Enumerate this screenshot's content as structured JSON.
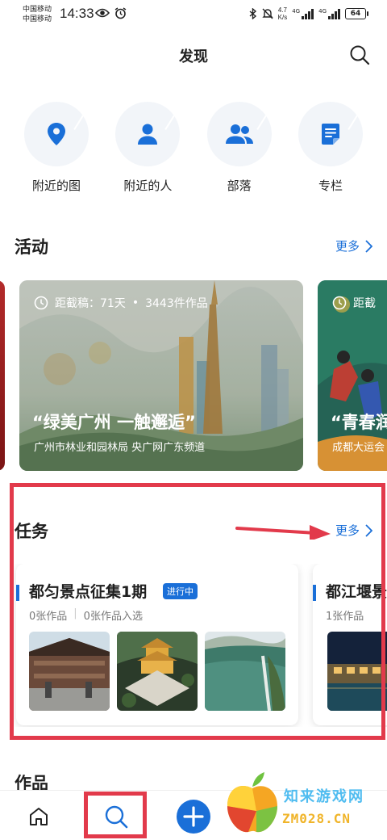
{
  "status_bar": {
    "carrier_1": "中国移动",
    "carrier_2": "中国移动",
    "time": "14:33",
    "net_speed_value": "4.7",
    "net_speed_unit": "K/s",
    "signal_tag_1": "4G",
    "signal_tag_2": "4G",
    "battery": "64",
    "icons": [
      "eye-icon",
      "alarm-icon",
      "bluetooth-icon",
      "mute-bell-icon",
      "signal-icon",
      "battery-icon"
    ]
  },
  "header": {
    "title": "发现",
    "search_icon": "search-icon"
  },
  "quick_entries": [
    {
      "label": "附近的图",
      "icon": "location-pin-icon"
    },
    {
      "label": "附近的人",
      "icon": "person-icon"
    },
    {
      "label": "部落",
      "icon": "group-icon"
    },
    {
      "label": "专栏",
      "icon": "document-icon"
    }
  ],
  "activity": {
    "title": "活动",
    "more": "更多",
    "cards": [
      {
        "deadline": "距截稿：71天",
        "dot": "•",
        "count": "3443件作品",
        "title": "“绿美广州 一触邂逅”",
        "subtitle": "广州市林业和园林局 央广网广东频道"
      },
      {
        "deadline": "距截",
        "title": "“青春润",
        "subtitle": "成都大运会"
      }
    ]
  },
  "tasks": {
    "title": "任务",
    "more": "更多",
    "cards": [
      {
        "title": "都匀景点征集1期",
        "badge": "进行中",
        "works": "0张作品",
        "selected": "0张作品入选"
      },
      {
        "title": "都江堰景",
        "works": "1张作品"
      }
    ]
  },
  "works": {
    "title": "作品"
  },
  "bottom_nav": [
    {
      "name": "home",
      "icon": "home-icon"
    },
    {
      "name": "discover",
      "icon": "search-icon"
    },
    {
      "name": "publish",
      "icon": "plus-icon"
    }
  ],
  "watermark": {
    "line1": "知来游戏网",
    "line2": "ZM028.CN"
  },
  "colors": {
    "accent": "#1a6fd8",
    "highlight": "#e23a4b",
    "icon_bg": "#f2f5f9"
  }
}
